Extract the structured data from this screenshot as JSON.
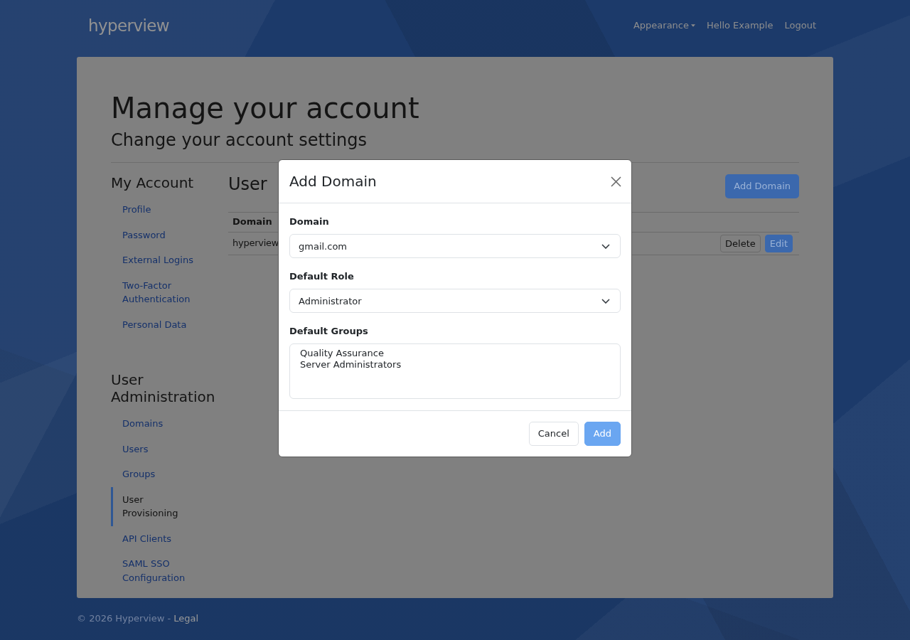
{
  "navbar": {
    "logo": "hyperview",
    "items": [
      {
        "label": "Appearance",
        "kind": "dropdown"
      },
      {
        "label": "Hello Example",
        "kind": "link"
      },
      {
        "label": "Logout",
        "kind": "link"
      }
    ]
  },
  "page": {
    "title": "Manage your account",
    "subtitle": "Change your account settings"
  },
  "sidebar": {
    "sections": [
      {
        "heading": "My Account",
        "items": [
          {
            "label": "Profile",
            "selected": false
          },
          {
            "label": "Password",
            "selected": false
          },
          {
            "label": "External Logins",
            "selected": false
          },
          {
            "label": "Two-Factor Authentication",
            "selected": false
          },
          {
            "label": "Personal Data",
            "selected": false
          }
        ]
      },
      {
        "heading": "User Administration",
        "items": [
          {
            "label": "Domains",
            "selected": false
          },
          {
            "label": "Users",
            "selected": false
          },
          {
            "label": "Groups",
            "selected": false
          },
          {
            "label": "User Provisioning",
            "selected": true
          },
          {
            "label": "API Clients",
            "selected": false
          },
          {
            "label": "SAML SSO Configuration",
            "selected": false
          }
        ]
      }
    ]
  },
  "content": {
    "heading": "User",
    "add_button": "Add Domain",
    "table": {
      "columns": [
        "Domain"
      ],
      "rows": [
        {
          "cells": [
            "hyperview"
          ],
          "actions": [
            {
              "label": "Delete",
              "kind": "delete"
            },
            {
              "label": "Edit",
              "kind": "edit"
            }
          ]
        }
      ]
    }
  },
  "modal": {
    "title": "Add Domain",
    "fields": [
      {
        "kind": "select",
        "label": "Domain",
        "value": "gmail.com"
      },
      {
        "kind": "select",
        "label": "Default Role",
        "value": "Administrator"
      },
      {
        "kind": "listbox",
        "label": "Default Groups",
        "options": [
          {
            "label": "Quality Assurance",
            "selected": false
          },
          {
            "label": "Server Administrators",
            "selected": false
          }
        ]
      }
    ],
    "buttons": [
      {
        "label": "Cancel",
        "kind": "cancel",
        "disabled": false
      },
      {
        "label": "Add",
        "kind": "submit",
        "disabled": true
      }
    ]
  },
  "footer": {
    "copyright": "© 2026 Hyperview -",
    "link": "Legal"
  }
}
